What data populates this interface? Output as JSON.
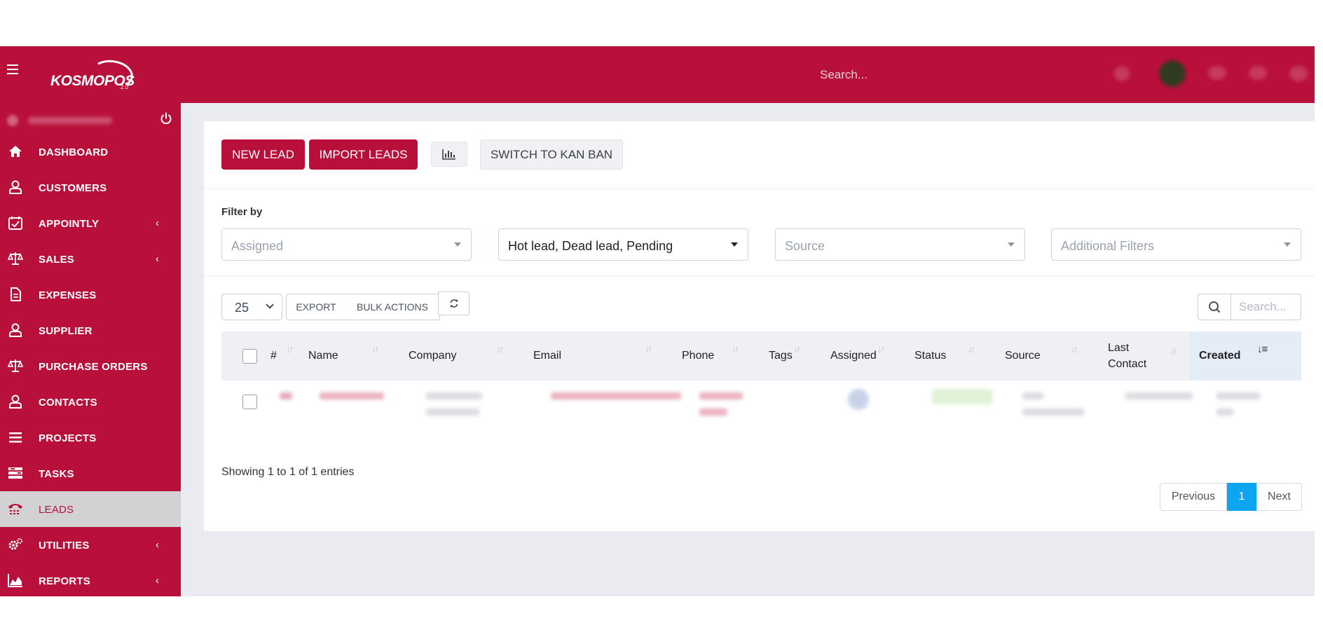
{
  "header": {
    "logo_text": "KOSMOPOS",
    "logo_sub": "2.0",
    "search_label": "Search..."
  },
  "sidebar": {
    "items": [
      {
        "label": "DASHBOARD",
        "icon": "home-icon"
      },
      {
        "label": "CUSTOMERS",
        "icon": "user-icon"
      },
      {
        "label": "APPOINTLY",
        "icon": "calendar-check-icon",
        "chevron": "‹"
      },
      {
        "label": "SALES",
        "icon": "balance-scale-icon",
        "chevron": "‹"
      },
      {
        "label": "EXPENSES",
        "icon": "document-icon"
      },
      {
        "label": "SUPPLIER",
        "icon": "user-icon"
      },
      {
        "label": "PURCHASE ORDERS",
        "icon": "balance-scale-icon"
      },
      {
        "label": "CONTACTS",
        "icon": "user-icon"
      },
      {
        "label": "PROJECTS",
        "icon": "bars-icon"
      },
      {
        "label": "TASKS",
        "icon": "tasks-icon"
      },
      {
        "label": "LEADS",
        "icon": "tty-icon",
        "active": true
      },
      {
        "label": "UTILITIES",
        "icon": "cogs-icon",
        "chevron": "‹"
      },
      {
        "label": "REPORTS",
        "icon": "area-chart-icon",
        "chevron": "‹"
      }
    ]
  },
  "toolbar": {
    "new_lead": "NEW LEAD",
    "import_leads": "IMPORT LEADS",
    "switch_kanban": "SWITCH TO KAN BAN"
  },
  "filters": {
    "label": "Filter by",
    "assigned": "Assigned",
    "status": "Hot lead, Dead lead, Pending",
    "source": "Source",
    "additional": "Additional Filters"
  },
  "table_controls": {
    "page_size": "25",
    "export": "EXPORT",
    "bulk_actions": "BULK ACTIONS",
    "search_placeholder": "Search..."
  },
  "table": {
    "columns": {
      "num": "#",
      "name": "Name",
      "company": "Company",
      "email": "Email",
      "phone": "Phone",
      "tags": "Tags",
      "assigned": "Assigned",
      "status": "Status",
      "source": "Source",
      "last_contact_1": "Last",
      "last_contact_2": "Contact",
      "created": "Created"
    }
  },
  "footer": {
    "showing": "Showing 1 to 1 of 1 entries",
    "previous": "Previous",
    "page": "1",
    "next": "Next"
  },
  "colors": {
    "brand": "#b90f3b",
    "active_page": "#0ea5f0"
  }
}
